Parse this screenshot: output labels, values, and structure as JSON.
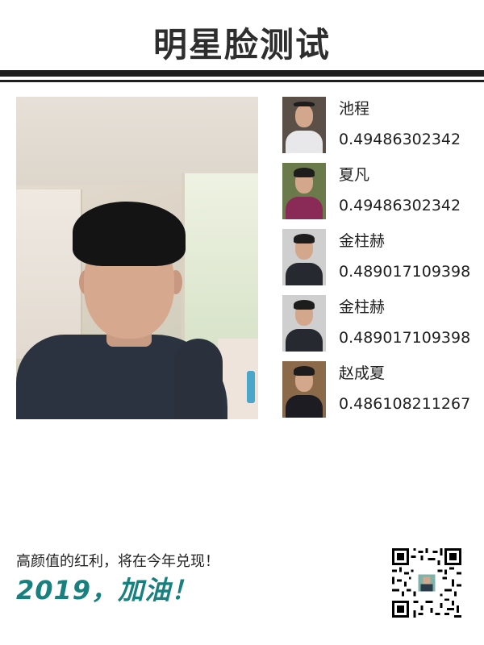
{
  "header": {
    "title": "明星脸测试"
  },
  "colors": {
    "title": "#2e2e2e",
    "rule": "#1e1e1e",
    "accent": "#18807e"
  },
  "matches": [
    {
      "name": "池程",
      "score": "0.49486302342"
    },
    {
      "name": "夏凡",
      "score": "0.49486302342"
    },
    {
      "name": "金柱赫",
      "score": "0.489017109398"
    },
    {
      "name": "金柱赫",
      "score": "0.489017109398"
    },
    {
      "name": "赵成夏",
      "score": "0.486108211267"
    }
  ],
  "footer": {
    "slogan": "高颜值的红利，将在今年兑现！",
    "cheer": "2019，加油！",
    "qr_icon": "qr-code-icon"
  }
}
